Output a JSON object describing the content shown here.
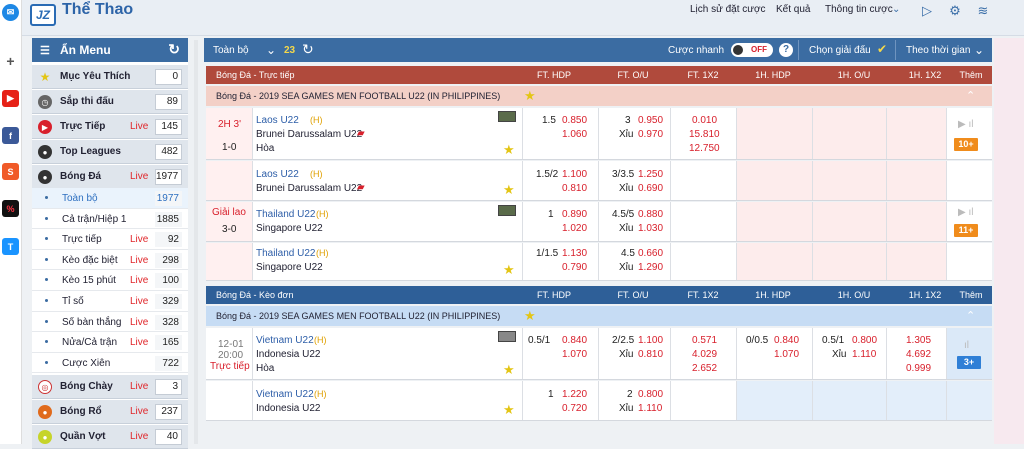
{
  "app": {
    "title": "Thể Thao",
    "logo": "JZ"
  },
  "topnav": [
    "Lịch sử đặt cược",
    "Kết quả",
    "Thông tin cược"
  ],
  "sidebar": {
    "header": "Ẩn Menu",
    "items": [
      {
        "label": "Mục Yêu Thích",
        "live": "",
        "count": "0"
      },
      {
        "label": "Sắp thi đấu",
        "live": "",
        "count": "89"
      },
      {
        "label": "Trực Tiếp",
        "live": "Live",
        "count": "145"
      },
      {
        "label": "Top Leagues",
        "live": "",
        "count": "482"
      },
      {
        "label": "Bóng Đá",
        "live": "Live",
        "count": "1977"
      }
    ],
    "subitems": [
      {
        "label": "Toàn bộ",
        "live": "",
        "count": "1977"
      },
      {
        "label": "Cả trận/Hiệp 1",
        "live": "",
        "count": "1885"
      },
      {
        "label": "Trực tiếp",
        "live": "Live",
        "count": "92"
      },
      {
        "label": "Kèo đặc biệt",
        "live": "Live",
        "count": "298"
      },
      {
        "label": "Kèo 15 phút",
        "live": "Live",
        "count": "100"
      },
      {
        "label": "Tỉ số",
        "live": "Live",
        "count": "329"
      },
      {
        "label": "Số bàn thắng",
        "live": "Live",
        "count": "328"
      },
      {
        "label": "Nửa/Cả trận",
        "live": "Live",
        "count": "165"
      },
      {
        "label": "Cược Xiên",
        "live": "",
        "count": "722"
      }
    ],
    "items2": [
      {
        "label": "Bóng Chày",
        "live": "Live",
        "count": "3"
      },
      {
        "label": "Bóng Rổ",
        "live": "Live",
        "count": "237"
      },
      {
        "label": "Quần Vợt",
        "live": "Live",
        "count": "40"
      }
    ]
  },
  "toolbar": {
    "all": "Toàn bộ",
    "count": "23",
    "quick_bet": "Cược nhanh",
    "toggle": "OFF",
    "help": "?",
    "choose_league": "Chọn giải đấu",
    "by_time": "Theo thời gian"
  },
  "columns": [
    "FT. HDP",
    "FT. O/U",
    "FT. 1X2",
    "1H. HDP",
    "1H. O/U",
    "1H. 1X2",
    "Thêm"
  ],
  "sections": [
    {
      "title": "Bóng Đá - Trực tiếp",
      "league": "Bóng Đá - 2019 SEA GAMES MEN FOOTBALL U22 (IN PHILIPPINES)"
    },
    {
      "title": "Bóng Đá - Kèo đơn",
      "league": "Bóng Đá - 2019 SEA GAMES MEN FOOTBALL U22 (IN PHILIPPINES)"
    }
  ],
  "matches": [
    {
      "time": "2H 3'",
      "score": "1-0",
      "home": "Laos U22",
      "h": "(H)",
      "away": "Brunei Darussalam U22",
      "draw": "Hòa",
      "hdp_line": "1.5",
      "hdp_h": "0.850",
      "hdp_a": "1.060",
      "ou_line": "3",
      "ou_o": "0.950",
      "ou_u_label": "Xỉu",
      "ou_u": "0.970",
      "x1": "0.010",
      "x2": "15.810",
      "xd": "12.750",
      "more": "10+"
    },
    {
      "time": "",
      "score": "",
      "home": "Laos U22",
      "h": "(H)",
      "away": "Brunei Darussalam U22",
      "draw": "",
      "hdp_line": "1.5/2",
      "hdp_h": "1.100",
      "hdp_a": "0.810",
      "ou_line": "3/3.5",
      "ou_o": "1.250",
      "ou_u_label": "Xỉu",
      "ou_u": "0.690",
      "x1": "",
      "x2": "",
      "xd": "",
      "more": ""
    },
    {
      "time": "Giải lao",
      "score": "3-0",
      "home": "Thailand U22",
      "h": "(H)",
      "away": "Singapore U22",
      "draw": "",
      "hdp_line": "1",
      "hdp_h": "0.890",
      "hdp_a": "1.020",
      "ou_line": "4.5/5",
      "ou_o": "0.880",
      "ou_u_label": "Xỉu",
      "ou_u": "1.030",
      "x1": "",
      "x2": "",
      "xd": "",
      "more": "11+"
    },
    {
      "time": "",
      "score": "",
      "home": "Thailand U22",
      "h": "(H)",
      "away": "Singapore U22",
      "draw": "",
      "hdp_line": "1/1.5",
      "hdp_h": "1.130",
      "hdp_a": "0.790",
      "ou_line": "4.5",
      "ou_o": "0.660",
      "ou_u_label": "Xỉu",
      "ou_u": "1.290",
      "x1": "",
      "x2": "",
      "xd": "",
      "more": ""
    },
    {
      "time": "12-01",
      "time2": "20:00",
      "time3": "Trực tiếp",
      "score": "",
      "home": "Vietnam U22",
      "h": "(H)",
      "away": "Indonesia U22",
      "draw": "Hòa",
      "hdp_line": "0.5/1",
      "hdp_h": "0.840",
      "hdp_a": "1.070",
      "ou_line": "2/2.5",
      "ou_o": "1.100",
      "ou_u_label": "Xỉu",
      "ou_u": "0.810",
      "x1": "0.571",
      "x2": "4.029",
      "xd": "2.652",
      "h_line": "0/0.5",
      "h_h": "0.840",
      "h_a": "1.070",
      "hou_line": "0.5/1",
      "hou_o": "0.800",
      "hou_u_label": "Xỉu",
      "hou_u": "1.110",
      "h1": "1.305",
      "h2": "4.692",
      "hd": "0.999",
      "more": "3+"
    },
    {
      "time": "",
      "score": "",
      "home": "Vietnam U22",
      "h": "(H)",
      "away": "Indonesia U22",
      "draw": "",
      "hdp_line": "1",
      "hdp_h": "1.220",
      "hdp_a": "0.720",
      "ou_line": "2",
      "ou_o": "0.800",
      "ou_u_label": "Xỉu",
      "ou_u": "1.110",
      "x1": "",
      "x2": "",
      "xd": "",
      "more": ""
    }
  ]
}
